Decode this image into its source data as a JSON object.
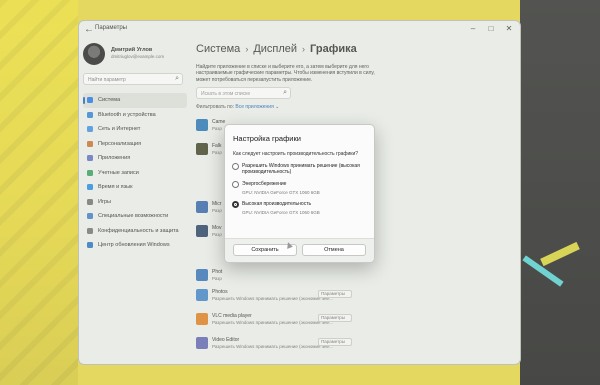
{
  "window": {
    "title": "Параметры",
    "back_icon": "back-arrow-icon",
    "controls": [
      "minimize-icon",
      "maximize-icon",
      "close-icon"
    ]
  },
  "profile": {
    "name": "Дмитрий Углов",
    "email": "dmitriuglov@example.com"
  },
  "sidebar": {
    "search_placeholder": "Найти параметр",
    "items": [
      {
        "label": "Система",
        "icon": "system-icon",
        "color": "#1a73e8",
        "active": true
      },
      {
        "label": "Bluetooth и устройства",
        "icon": "bluetooth-icon",
        "color": "#2b7fd6",
        "active": false
      },
      {
        "label": "Сеть и Интернет",
        "icon": "network-icon",
        "color": "#3b8ee6",
        "active": false
      },
      {
        "label": "Персонализация",
        "icon": "brush-icon",
        "color": "#c86b28",
        "active": false
      },
      {
        "label": "Приложения",
        "icon": "apps-icon",
        "color": "#5c6bc0",
        "active": false
      },
      {
        "label": "Учетные записи",
        "icon": "account-icon",
        "color": "#2e9d5b",
        "active": false
      },
      {
        "label": "Время и язык",
        "icon": "clock-icon",
        "color": "#1e88e5",
        "active": false
      },
      {
        "label": "Игры",
        "icon": "gamepad-icon",
        "color": "#6d6d6d",
        "active": false
      },
      {
        "label": "Специальные возможности",
        "icon": "accessibility-icon",
        "color": "#3979c4",
        "active": false
      },
      {
        "label": "Конфиденциальность и защита",
        "icon": "shield-icon",
        "color": "#6f6f6f",
        "active": false
      },
      {
        "label": "Центр обновления Windows",
        "icon": "update-icon",
        "color": "#1f6fc1",
        "active": false
      }
    ]
  },
  "main": {
    "breadcrumb": [
      "Система",
      "Дисплей",
      "Графика"
    ],
    "intro": "Найдите приложение в списке и выберите его, а затем выберите для него настраиваемые графические параметры. Чтобы изменения вступили в силу, может потребоваться перезапустить приложение.",
    "search_placeholder": "Искать в этом списке",
    "filter_label": "Фильтровать по:",
    "filter_value": "Все приложения",
    "apps": [
      {
        "name": "Came",
        "sub": "Разр",
        "icon_color": "#1e6fb5",
        "select": ""
      },
      {
        "name": "Falk",
        "sub": "Разр",
        "icon_color": "#3a3a1e",
        "select": ""
      },
      {
        "name": "Micr",
        "sub": "Разр",
        "icon_color": "#2b5fa8",
        "select": ""
      },
      {
        "name": "Mov",
        "sub": "Разр",
        "icon_color": "#203a60",
        "select": ""
      },
      {
        "name": "Phot",
        "sub": "Разр",
        "icon_color": "#2b6cb8",
        "select": ""
      },
      {
        "name": "Photos",
        "sub": "Разрешить Windows принимать решение (экономия эне...",
        "icon_color": "#3a7fc9",
        "select": "Параметры"
      },
      {
        "name": "VLC media player",
        "sub": "Разрешить Windows принимать решение (экономия эне...",
        "icon_color": "#e07b16",
        "select": "Параметры"
      },
      {
        "name": "Video Editor",
        "sub": "Разрешить Windows принимать решение (экономия эне...",
        "icon_color": "#5a5fb0",
        "select": "Параметры"
      }
    ]
  },
  "dialog": {
    "title": "Настройка графики",
    "question": "Как следует настроить производительность графики?",
    "options": [
      {
        "label": "Разрешить Windows принимать решение (высокая производительность)",
        "gpu": "",
        "checked": false
      },
      {
        "label": "Энергосбережение",
        "gpu": "GPU: NVIDIA GeForce GTX 1060 6GB",
        "checked": false
      },
      {
        "label": "Высокая производительность",
        "gpu": "GPU: NVIDIA GeForce GTX 1060 6GB",
        "checked": true
      }
    ],
    "save_label": "Сохранить",
    "cancel_label": "Отмена"
  }
}
